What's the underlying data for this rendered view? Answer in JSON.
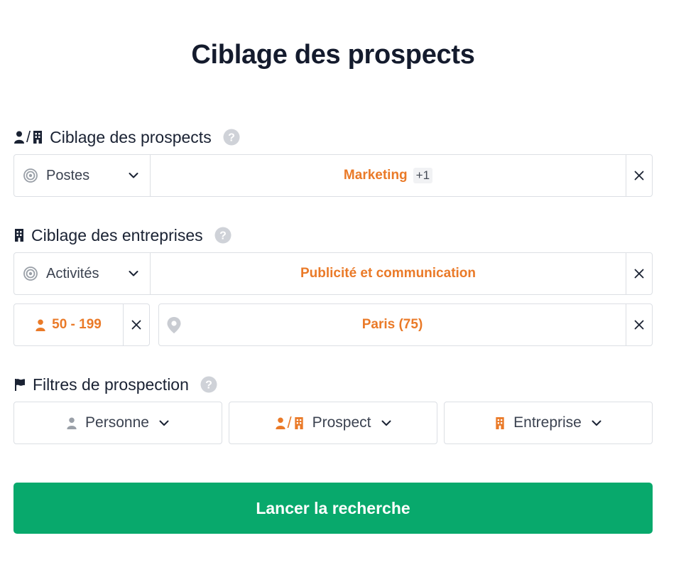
{
  "page": {
    "title": "Ciblage des prospects"
  },
  "prospects": {
    "header": "Ciblage des prospects",
    "slash": "/",
    "select_label": "Postes",
    "value": "Marketing",
    "extra_count": "+1"
  },
  "companies": {
    "header": "Ciblage des entreprises",
    "select_label": "Activités",
    "value": "Publicité et communication",
    "size_value": "50 - 199",
    "location_value": "Paris (75)"
  },
  "filters": {
    "header": "Filtres de prospection",
    "person_label": "Personne",
    "prospect_slash": "/",
    "prospect_label": "Prospect",
    "company_label": "Entreprise"
  },
  "actions": {
    "search_label": "Lancer la recherche"
  },
  "colors": {
    "accent": "#ea7a28",
    "primary": "#08a96c",
    "text": "#1a2233",
    "border": "#dcdfe4",
    "help": "#cfd2d8"
  },
  "icons": [
    "person-icon",
    "building-icon",
    "help-icon",
    "target-icon",
    "chevron-down-icon",
    "close-icon",
    "map-pin-icon",
    "flag-icon"
  ]
}
